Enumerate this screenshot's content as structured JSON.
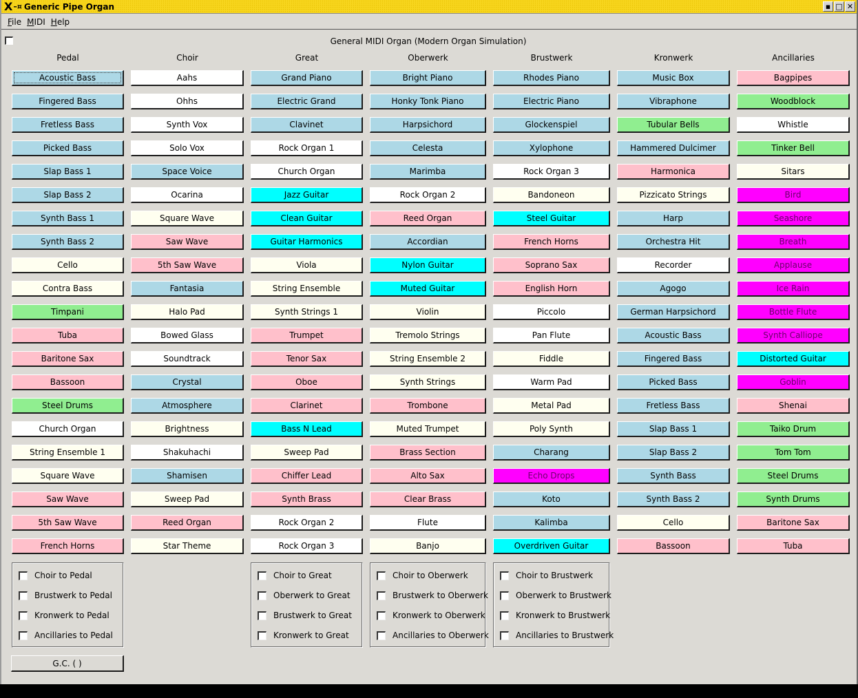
{
  "window": {
    "title": "Generic Pipe Organ",
    "icons": [
      "x-logo-icon",
      "pin-icon"
    ],
    "controls": [
      {
        "name": "minimize-button",
        "glyph": "▪"
      },
      {
        "name": "maximize-button",
        "glyph": "□"
      },
      {
        "name": "close-button",
        "glyph": "✕"
      }
    ]
  },
  "menu": [
    {
      "label": "File",
      "accel": "F",
      "rest": "ile"
    },
    {
      "label": "MIDI",
      "accel": "M",
      "rest": "IDI"
    },
    {
      "label": "Help",
      "accel": "H",
      "rest": "elp"
    }
  ],
  "organ_title": "General MIDI Organ (Modern Organ Simulation)",
  "top_checkbox_checked": false,
  "colors": {
    "lightblue": "#add8e6",
    "white": "#ffffff",
    "lightyellow": "#fffff0",
    "pink": "#ffc0cb",
    "cyan": "#00ffff",
    "lightgreen": "#90ee90",
    "magenta": "#ff00ff"
  },
  "divisions": [
    {
      "name": "Pedal",
      "stops": [
        {
          "label": "Acoustic Bass",
          "color": "lightblue",
          "focused": true
        },
        {
          "label": "Fingered Bass",
          "color": "lightblue"
        },
        {
          "label": "Fretless Bass",
          "color": "lightblue"
        },
        {
          "label": "Picked Bass",
          "color": "lightblue"
        },
        {
          "label": "Slap Bass 1",
          "color": "lightblue"
        },
        {
          "label": "Slap Bass 2",
          "color": "lightblue"
        },
        {
          "label": "Synth Bass 1",
          "color": "lightblue"
        },
        {
          "label": "Synth Bass 2",
          "color": "lightblue"
        },
        {
          "label": "Cello",
          "color": "lightyellow"
        },
        {
          "label": "Contra Bass",
          "color": "lightyellow"
        },
        {
          "label": "Timpani",
          "color": "lightgreen"
        },
        {
          "label": "Tuba",
          "color": "pink"
        },
        {
          "label": "Baritone Sax",
          "color": "pink"
        },
        {
          "label": "Bassoon",
          "color": "pink"
        },
        {
          "label": "Steel Drums",
          "color": "lightgreen"
        },
        {
          "label": "Church Organ",
          "color": "white"
        },
        {
          "label": "String Ensemble 1",
          "color": "lightyellow"
        },
        {
          "label": "Square Wave",
          "color": "lightyellow"
        },
        {
          "label": "Saw Wave",
          "color": "pink"
        },
        {
          "label": "5th Saw Wave",
          "color": "pink"
        },
        {
          "label": "French Horns",
          "color": "pink"
        }
      ]
    },
    {
      "name": "Choir",
      "stops": [
        {
          "label": "Aahs",
          "color": "white"
        },
        {
          "label": "Ohhs",
          "color": "white"
        },
        {
          "label": "Synth Vox",
          "color": "white"
        },
        {
          "label": "Solo Vox",
          "color": "white"
        },
        {
          "label": "Space Voice",
          "color": "lightblue"
        },
        {
          "label": "Ocarina",
          "color": "white"
        },
        {
          "label": "Square Wave",
          "color": "lightyellow"
        },
        {
          "label": "Saw Wave",
          "color": "pink"
        },
        {
          "label": "5th Saw Wave",
          "color": "pink"
        },
        {
          "label": "Fantasia",
          "color": "lightblue"
        },
        {
          "label": "Halo Pad",
          "color": "lightyellow"
        },
        {
          "label": "Bowed Glass",
          "color": "white"
        },
        {
          "label": "Soundtrack",
          "color": "white"
        },
        {
          "label": "Crystal",
          "color": "lightblue"
        },
        {
          "label": "Atmosphere",
          "color": "lightblue"
        },
        {
          "label": "Brightness",
          "color": "lightyellow"
        },
        {
          "label": "Shakuhachi",
          "color": "white"
        },
        {
          "label": "Shamisen",
          "color": "lightblue"
        },
        {
          "label": "Sweep Pad",
          "color": "lightyellow"
        },
        {
          "label": "Reed Organ",
          "color": "pink"
        },
        {
          "label": "Star Theme",
          "color": "lightyellow"
        }
      ]
    },
    {
      "name": "Great",
      "stops": [
        {
          "label": "Grand Piano",
          "color": "lightblue"
        },
        {
          "label": "Electric Grand",
          "color": "lightblue"
        },
        {
          "label": "Clavinet",
          "color": "lightblue"
        },
        {
          "label": "Rock Organ 1",
          "color": "white"
        },
        {
          "label": "Church Organ",
          "color": "white"
        },
        {
          "label": "Jazz Guitar",
          "color": "cyan"
        },
        {
          "label": "Clean Guitar",
          "color": "cyan"
        },
        {
          "label": "Guitar Harmonics",
          "color": "cyan"
        },
        {
          "label": "Viola",
          "color": "lightyellow"
        },
        {
          "label": "String Ensemble",
          "color": "lightyellow"
        },
        {
          "label": "Synth Strings 1",
          "color": "lightyellow"
        },
        {
          "label": "Trumpet",
          "color": "pink"
        },
        {
          "label": "Tenor Sax",
          "color": "pink"
        },
        {
          "label": "Oboe",
          "color": "pink"
        },
        {
          "label": "Clarinet",
          "color": "pink"
        },
        {
          "label": "Bass N Lead",
          "color": "cyan"
        },
        {
          "label": "Sweep Pad",
          "color": "lightyellow"
        },
        {
          "label": "Chiffer Lead",
          "color": "pink"
        },
        {
          "label": "Synth Brass",
          "color": "pink"
        },
        {
          "label": "Rock Organ 2",
          "color": "white"
        },
        {
          "label": "Rock Organ 3",
          "color": "white"
        }
      ]
    },
    {
      "name": "Oberwerk",
      "stops": [
        {
          "label": "Bright Piano",
          "color": "lightblue"
        },
        {
          "label": "Honky Tonk Piano",
          "color": "lightblue"
        },
        {
          "label": "Harpsichord",
          "color": "lightblue"
        },
        {
          "label": "Celesta",
          "color": "lightblue"
        },
        {
          "label": "Marimba",
          "color": "lightblue"
        },
        {
          "label": "Rock Organ 2",
          "color": "white"
        },
        {
          "label": "Reed Organ",
          "color": "pink"
        },
        {
          "label": "Accordian",
          "color": "lightblue"
        },
        {
          "label": "Nylon Guitar",
          "color": "cyan"
        },
        {
          "label": "Muted Guitar",
          "color": "cyan"
        },
        {
          "label": "Violin",
          "color": "lightyellow"
        },
        {
          "label": "Tremolo Strings",
          "color": "lightyellow"
        },
        {
          "label": "String Ensemble 2",
          "color": "lightyellow"
        },
        {
          "label": "Synth Strings",
          "color": "lightyellow"
        },
        {
          "label": "Trombone",
          "color": "pink"
        },
        {
          "label": "Muted Trumpet",
          "color": "lightyellow"
        },
        {
          "label": "Brass Section",
          "color": "pink"
        },
        {
          "label": "Alto Sax",
          "color": "pink"
        },
        {
          "label": "Clear Brass",
          "color": "pink"
        },
        {
          "label": "Flute",
          "color": "white"
        },
        {
          "label": "Banjo",
          "color": "lightyellow"
        }
      ]
    },
    {
      "name": "Brustwerk",
      "stops": [
        {
          "label": "Rhodes Piano",
          "color": "lightblue"
        },
        {
          "label": "Electric Piano",
          "color": "lightblue"
        },
        {
          "label": "Glockenspiel",
          "color": "lightblue"
        },
        {
          "label": "Xylophone",
          "color": "lightblue"
        },
        {
          "label": "Rock Organ 3",
          "color": "white"
        },
        {
          "label": "Bandoneon",
          "color": "lightyellow"
        },
        {
          "label": "Steel Guitar",
          "color": "cyan"
        },
        {
          "label": "French Horns",
          "color": "pink"
        },
        {
          "label": "Soprano Sax",
          "color": "pink"
        },
        {
          "label": "English Horn",
          "color": "pink"
        },
        {
          "label": "Piccolo",
          "color": "white"
        },
        {
          "label": "Pan Flute",
          "color": "white"
        },
        {
          "label": "Fiddle",
          "color": "lightyellow"
        },
        {
          "label": "Warm Pad",
          "color": "white"
        },
        {
          "label": "Metal Pad",
          "color": "lightyellow"
        },
        {
          "label": "Poly Synth",
          "color": "lightyellow"
        },
        {
          "label": "Charang",
          "color": "lightblue"
        },
        {
          "label": "Echo Drops",
          "color": "magenta"
        },
        {
          "label": "Koto",
          "color": "lightblue"
        },
        {
          "label": "Kalimba",
          "color": "lightblue"
        },
        {
          "label": "Overdriven Guitar",
          "color": "cyan"
        }
      ]
    },
    {
      "name": "Kronwerk",
      "stops": [
        {
          "label": "Music Box",
          "color": "lightblue"
        },
        {
          "label": "Vibraphone",
          "color": "lightblue"
        },
        {
          "label": "Tubular Bells",
          "color": "lightgreen"
        },
        {
          "label": "Hammered Dulcimer",
          "color": "lightblue"
        },
        {
          "label": "Harmonica",
          "color": "pink"
        },
        {
          "label": "Pizzicato Strings",
          "color": "lightyellow"
        },
        {
          "label": "Harp",
          "color": "lightblue"
        },
        {
          "label": "Orchestra Hit",
          "color": "lightblue"
        },
        {
          "label": "Recorder",
          "color": "white"
        },
        {
          "label": "Agogo",
          "color": "lightblue"
        },
        {
          "label": "German Harpsichord",
          "color": "lightblue"
        },
        {
          "label": "Acoustic Bass",
          "color": "lightblue"
        },
        {
          "label": "Fingered Bass",
          "color": "lightblue"
        },
        {
          "label": "Picked Bass",
          "color": "lightblue"
        },
        {
          "label": "Fretless Bass",
          "color": "lightblue"
        },
        {
          "label": "Slap Bass 1",
          "color": "lightblue"
        },
        {
          "label": "Slap Bass 2",
          "color": "lightblue"
        },
        {
          "label": "Synth Bass",
          "color": "lightblue"
        },
        {
          "label": "Synth Bass 2",
          "color": "lightblue"
        },
        {
          "label": "Cello",
          "color": "lightyellow"
        },
        {
          "label": "Bassoon",
          "color": "pink"
        }
      ]
    },
    {
      "name": "Ancillaries",
      "stops": [
        {
          "label": "Bagpipes",
          "color": "pink"
        },
        {
          "label": "Woodblock",
          "color": "lightgreen"
        },
        {
          "label": "Whistle",
          "color": "white"
        },
        {
          "label": "Tinker Bell",
          "color": "lightgreen"
        },
        {
          "label": "Sitars",
          "color": "lightyellow"
        },
        {
          "label": "Bird",
          "color": "magenta"
        },
        {
          "label": "Seashore",
          "color": "magenta"
        },
        {
          "label": "Breath",
          "color": "magenta"
        },
        {
          "label": "Applause",
          "color": "magenta"
        },
        {
          "label": "Ice Rain",
          "color": "magenta"
        },
        {
          "label": "Bottle Flute",
          "color": "magenta"
        },
        {
          "label": "Synth Calliope",
          "color": "magenta"
        },
        {
          "label": "Distorted Guitar",
          "color": "cyan"
        },
        {
          "label": "Goblin",
          "color": "magenta"
        },
        {
          "label": "Shenai",
          "color": "pink"
        },
        {
          "label": "Taiko Drum",
          "color": "lightgreen"
        },
        {
          "label": "Tom Tom",
          "color": "lightgreen"
        },
        {
          "label": "Steel Drums",
          "color": "lightgreen"
        },
        {
          "label": "Synth Drums",
          "color": "lightgreen"
        },
        {
          "label": "Baritone Sax",
          "color": "pink"
        },
        {
          "label": "Tuba",
          "color": "pink"
        }
      ]
    }
  ],
  "couplers": [
    {
      "division": "Pedal",
      "items": [
        {
          "label": "Choir to Pedal",
          "checked": false
        },
        {
          "label": "Brustwerk to Pedal",
          "checked": false
        },
        {
          "label": "Kronwerk to Pedal",
          "checked": false
        },
        {
          "label": "Ancillaries to Pedal",
          "checked": false
        }
      ]
    },
    {
      "division": "Great",
      "items": [
        {
          "label": "Choir to Great",
          "checked": false
        },
        {
          "label": "Oberwerk to Great",
          "checked": false
        },
        {
          "label": "Brustwerk to Great",
          "checked": false
        },
        {
          "label": "Kronwerk to Great",
          "checked": false
        }
      ]
    },
    {
      "division": "Oberwerk",
      "items": [
        {
          "label": "Choir to Oberwerk",
          "checked": false
        },
        {
          "label": "Brustwerk to Oberwerk",
          "checked": false
        },
        {
          "label": "Kronwerk to Oberwerk",
          "checked": false
        },
        {
          "label": "Ancillaries to Oberwerk",
          "checked": false
        }
      ]
    },
    {
      "division": "Brustwerk",
      "items": [
        {
          "label": "Choir to Brustwerk",
          "checked": false
        },
        {
          "label": "Oberwerk to Brustwerk",
          "checked": false
        },
        {
          "label": "Kronwerk to Brustwerk",
          "checked": false
        },
        {
          "label": "Ancillaries to Brustwerk",
          "checked": false
        }
      ]
    }
  ],
  "gc_button_label": "G.C. ( )"
}
